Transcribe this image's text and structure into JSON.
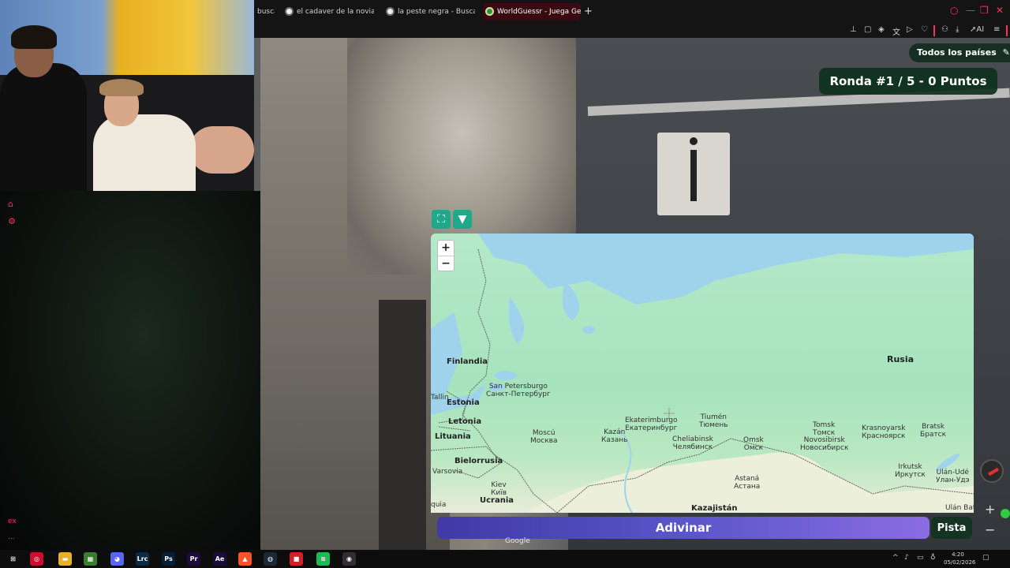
{
  "browser": {
    "tabs": [
      {
        "title": "buscar"
      },
      {
        "title": "el cadaver de la novia - Bu"
      },
      {
        "title": "la peste negra - Buscar co"
      },
      {
        "title": "WorldGuessr - Juega Geo"
      }
    ],
    "new_tab_symbol": "+",
    "window_controls": [
      "○",
      "—",
      "❐",
      "✕"
    ],
    "toolbar": {
      "ai_label": "AI"
    }
  },
  "sidebar": {
    "speed_label": "ex",
    "dots": "..."
  },
  "game": {
    "countries_pill": "Todos los países",
    "round_status": "Ronda #1 / 5 - 0 Puntos",
    "map_controls": {
      "fullscreen": "⛶",
      "pin": "📌"
    },
    "zoom": {
      "in": "+",
      "out": "−"
    },
    "guess_button": "Adivinar",
    "hint_button": "Pista",
    "attribution": "Google",
    "sv_zoom_in": "+",
    "sv_zoom_out": "−"
  },
  "map": {
    "countries": {
      "finlandia": "Finlandia",
      "estonia": "Estonia",
      "letonia": "Letonia",
      "lituania": "Lituania",
      "bielorrusia": "Bielorrusia",
      "ucrania": "Ucrania",
      "rusia": "Rusia",
      "kazajistan": "Kazajistán"
    },
    "cities": {
      "stpete": {
        "latin": "San Petersburgo",
        "cyr": "Санкт-Петербург"
      },
      "moscu": {
        "latin": "Moscú",
        "cyr": "Москва"
      },
      "kazan": {
        "latin": "Kazán",
        "cyr": "Казань"
      },
      "ekat": {
        "latin": "Ekaterimburgo",
        "cyr": "Екатеринбург"
      },
      "tiumen": {
        "latin": "Tiumén",
        "cyr": "Тюмень"
      },
      "chel": {
        "latin": "Cheliabinsk",
        "cyr": "Челябинск"
      },
      "omsk": {
        "latin": "Omsk",
        "cyr": "Омск"
      },
      "novo": {
        "latin": "Novosibirsk",
        "cyr": "Новосибирск"
      },
      "tomsk": {
        "latin": "Tomsk",
        "cyr": "Томск"
      },
      "krasno": {
        "latin": "Krasnoyarsk",
        "cyr": "Красноярск"
      },
      "bratsk": {
        "latin": "Bratsk",
        "cyr": "Братск"
      },
      "irkutsk": {
        "latin": "Irkutsk",
        "cyr": "Иркутск"
      },
      "ulande": {
        "latin": "Ulán-Udé",
        "cyr": "Улан-Удэ"
      },
      "astana": {
        "latin": "Astaná",
        "cyr": "Астана"
      },
      "kiev": {
        "latin": "Kiev",
        "cyr": "Київ"
      },
      "varsovia": {
        "latin": "Varsovia"
      },
      "ulanbat": {
        "latin": "Ulán Bat"
      },
      "tallinn": {
        "latin": "Tallin"
      },
      "quia": {
        "latin": "quia"
      }
    }
  },
  "taskbar": {
    "apps": [
      {
        "name": "start",
        "label": "⊞",
        "color": "#0d0d0d"
      },
      {
        "name": "browser-app",
        "label": "◎",
        "color": "#c8102e"
      },
      {
        "name": "file-explorer",
        "label": "▬",
        "color": "#e8b030"
      },
      {
        "name": "minecraft",
        "label": "▦",
        "color": "#3a7d2c"
      },
      {
        "name": "discord",
        "label": "◕",
        "color": "#5865f2"
      },
      {
        "name": "lightroom-classic",
        "label": "Lrc",
        "color": "#0b2a44"
      },
      {
        "name": "photoshop",
        "label": "Ps",
        "color": "#001e36"
      },
      {
        "name": "premiere",
        "label": "Pr",
        "color": "#1c0b3b"
      },
      {
        "name": "after-effects",
        "label": "Ae",
        "color": "#1b0b3b"
      },
      {
        "name": "brave",
        "label": "▲",
        "color": "#fb542b"
      },
      {
        "name": "steam",
        "label": "◍",
        "color": "#1b2838"
      },
      {
        "name": "app-red",
        "label": "■",
        "color": "#d0202a"
      },
      {
        "name": "spotify",
        "label": "≋",
        "color": "#1db954"
      },
      {
        "name": "obs",
        "label": "◉",
        "color": "#302e31"
      }
    ],
    "time": "4:20",
    "date": "05/02/2026"
  },
  "colors": {
    "accent": "#ff2e5a",
    "round_bg": "#0e301e",
    "guess_gradient_start": "#3f3aa6",
    "guess_gradient_end": "#8a6ce3",
    "map_land": "#a6e3bd",
    "map_water": "#9fd3ec"
  }
}
